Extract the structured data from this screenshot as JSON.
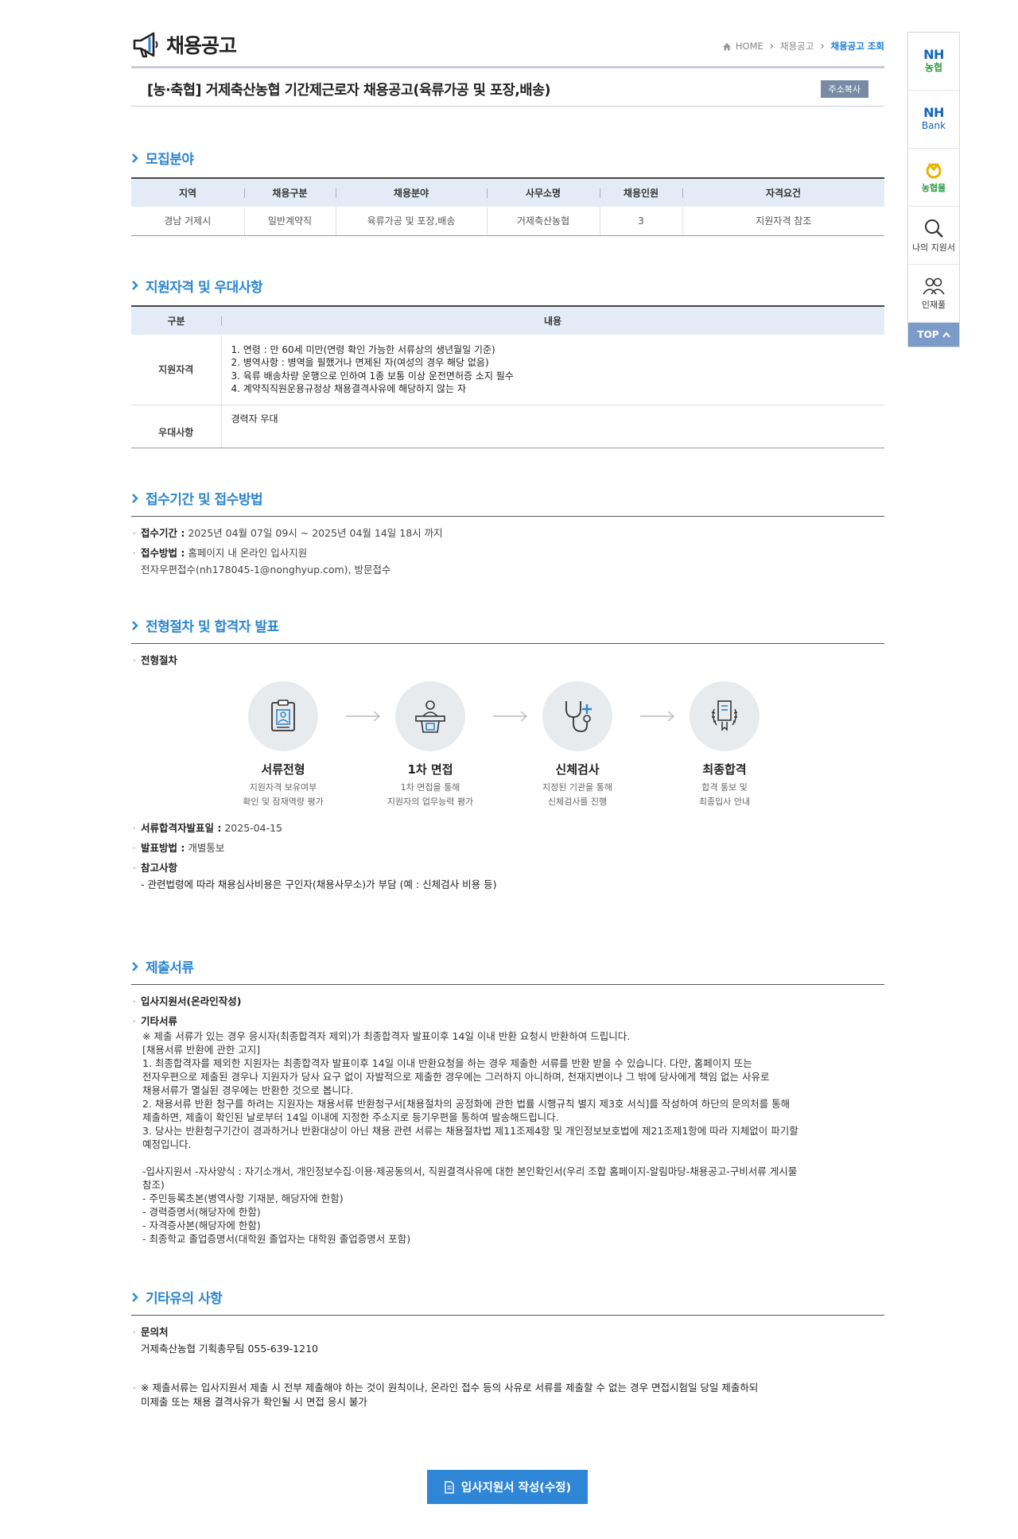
{
  "header": {
    "title": "채용공고",
    "breadcrumb": {
      "home": "HOME",
      "level1": "채용공고",
      "current": "채용공고 조회"
    }
  },
  "post": {
    "title": "[농·축협] 거제축산농협 기간제근로자 채용공고(육류가공 및 포장,배송)",
    "copy_label": "주소복사"
  },
  "recruit": {
    "heading": "모집분야",
    "columns": [
      "지역",
      "채용구분",
      "채용분야",
      "사무소명",
      "채용인원",
      "자격요건"
    ],
    "row": [
      "경남 거제시",
      "일반계약직",
      "육류가공 및 포장,배송",
      "거제축산농협",
      "3",
      "지원자격 참조"
    ]
  },
  "qualification": {
    "heading": "지원자격 및 우대사항",
    "col_category": "구분",
    "col_content": "내용",
    "req_label": "지원자격",
    "req_lines": [
      "1. 연령 : 만 60세 미만(연령 확인 가능한 서류상의 생년월일 기준)",
      "2. 병역사항 : 병역을 필했거나 면제된 자(여성의 경우 해당 없음)",
      "3. 육류 배송차량 운행으로 인하여 1종 보통 이상 운전면허증 소지 필수",
      "4. 계약직직원운용규정상 채용결격사유에 해당하지 않는 자"
    ],
    "pref_label": "우대사항",
    "pref_text": "경력자 우대"
  },
  "receipt": {
    "heading": "접수기간 및 접수방법",
    "period_label": "접수기간 :",
    "period_value": "2025년 04월 07일 09시 ~ 2025년 04월 14일 18시 까지",
    "method_label": "접수방법 :",
    "method_value": "홈페이지 내 온라인 입사지원",
    "method_extra": "전자우편접수(nh178045-1@nonghyup.com), 방문접수"
  },
  "process": {
    "heading": "전형절차 및 합격자 발표",
    "sub_label": "전형절차",
    "steps": [
      {
        "name": "서류전형",
        "desc1": "지원자격 보유여부",
        "desc2": "확인 및 잠재역량 평가",
        "icon": "document-profile-icon"
      },
      {
        "name": "1차 면접",
        "desc1": "1차 면접을 통해",
        "desc2": "지원자의 업무능력 평가",
        "icon": "interview-podium-icon"
      },
      {
        "name": "신체검사",
        "desc1": "지정된 기관을 통해",
        "desc2": "신체검사를 진행",
        "icon": "stethoscope-icon"
      },
      {
        "name": "최종합격",
        "desc1": "합격 통보 및",
        "desc2": "최종입사 안내",
        "icon": "laurel-certificate-icon"
      }
    ],
    "doc_pass_label": "서류합격자발표일 :",
    "doc_pass_value": "2025-04-15",
    "notice_label": "발표방법 :",
    "notice_value": "개별통보",
    "ref_label": "참고사항",
    "ref_text": "- 관련법령에 따라 채용심사비용은 구인자(채용사무소)가 부담 (예 : 신체검사 비용 등)"
  },
  "documents": {
    "heading": "제출서류",
    "item1": "입사지원서(온라인작성)",
    "item2": "기타서류",
    "lines": [
      "※ 제출 서류가 있는 경우 응시자(최종합격자 제외)가 최종합격자 발표이후 14일 이내 반환 요청시 반환하여 드립니다.",
      "[채용서류 반환에 관한 고지]",
      " 1. 최종합격자를 제외한 지원자는 최종합격자 발표이후 14일 이내 반환요청을 하는 경우 제출한 서류를 반환 받을 수 있습니다. 다만, 홈페이지 또는",
      "전자우편으로 제출된 경우나 지원자가 당사 요구 없이 자발적으로 제출한 경우에는 그러하지 아니하며, 천재지변이나 그 밖에 당사에게 책임 없는 사유로",
      "채용서류가 멸실된 경우에는 반환한 것으로 봅니다.",
      " 2. 채용서류 반환 청구를 하려는 지원자는 채용서류 반환청구서[채용절차의 공정화에 관한 법률 시행규칙 별지 제3호 서식]를 작성하여 하단의 문의처를 통해",
      "제출하면, 제출이 확인된 날로부터 14일 이내에 지정한 주소지로 등기우편을 통하여 발송해드립니다.",
      " 3. 당사는 반환청구기간이 경과하거나 반환대상이 아닌 채용 관련 서류는 채용절차법 제11조제4항 및 개인정보보호법에 제21조제1항에 따라 지체없이 파기할",
      "예정입니다.",
      "",
      " -입사지원서 -자사양식 : 자기소개서, 개인정보수집·이용·제공동의서, 직원결격사유에 대한 본인확인서(우리 조합 홈페이지-알림마당-채용공고-구비서류 게시물",
      "참조)",
      "- 주민등록초본(병역사항 기재분, 해당자에 한함)",
      "- 경력증명서(해당자에 한함)",
      "- 자격증사본(해당자에 한함)",
      "- 최종학교 졸업증명서(대학원 졸업자는 대학원 졸업증명서 포함)"
    ]
  },
  "other": {
    "heading": "기타유의 사항",
    "contact_label": "문의처",
    "contact_value": "거제축산농협 기획총무팀 055-639-1210",
    "note_line1": "※ 제출서류는 입사지원서 제출 시 전부 제출해야 하는 것이 원칙이나, 온라인 접수 등의 사유로 서류를 제출할 수 없는 경우 면접시험일 당일 제출하되",
    "note_line2": "미제출 또는 채용 결격사유가 확인될 시 면접 응시 불가"
  },
  "apply_label": "입사지원서 작성(수정)",
  "quick": {
    "nh1_top": "NH",
    "nh1_bottom": "농협",
    "nh2_top": "NH",
    "nh2_bottom": "Bank",
    "mall_label": "농협몰",
    "my_app_label": "나의 지원서",
    "talent_label": "인재풀",
    "top_label": "TOP"
  },
  "colors": {
    "accent": "#2d86cf",
    "button": "#2f86d6",
    "table_head": "#e3ecf6"
  }
}
